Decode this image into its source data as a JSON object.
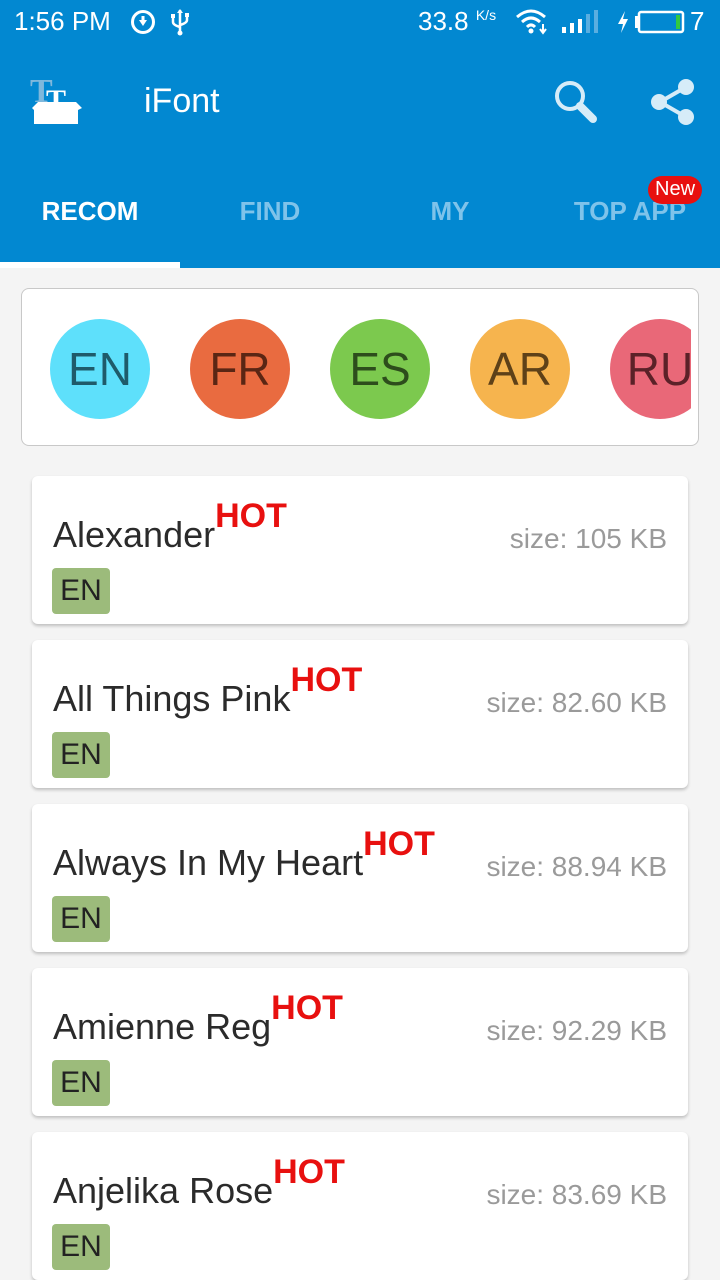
{
  "status_bar": {
    "time": "1:56 PM",
    "net_speed": "33.8",
    "net_speed_unit": "K/s",
    "battery_level": "7"
  },
  "toolbar": {
    "title": "iFont",
    "logo_icon": "ifont-box-logo-icon",
    "search_icon": "search-icon",
    "share_icon": "share-icon"
  },
  "tabs": [
    {
      "label": "RECOM",
      "active": true
    },
    {
      "label": "FIND",
      "active": false
    },
    {
      "label": "MY",
      "active": false
    },
    {
      "label": "TOP APP",
      "active": false,
      "badge": "New"
    }
  ],
  "languages": [
    {
      "code": "EN",
      "color": "#5ee0fb",
      "text_color": "#1f5b6a"
    },
    {
      "code": "FR",
      "color": "#e96b40",
      "text_color": "#5a2614"
    },
    {
      "code": "ES",
      "color": "#7cc94e",
      "text_color": "#2d4d1c"
    },
    {
      "code": "AR",
      "color": "#f6b44e",
      "text_color": "#5e4118"
    },
    {
      "code": "RU",
      "color": "#e96878",
      "text_color": "#5b2128"
    }
  ],
  "fonts": [
    {
      "name": "Alexander",
      "hot": "HOT",
      "size": "size: 105 KB",
      "lang": "EN"
    },
    {
      "name": "All Things Pink",
      "hot": "HOT",
      "size": "size: 82.60 KB",
      "lang": "EN"
    },
    {
      "name": "Always In My Heart",
      "hot": "HOT",
      "size": "size: 88.94 KB",
      "lang": "EN"
    },
    {
      "name": "Amienne Reg",
      "hot": "HOT",
      "size": "size: 92.29 KB",
      "lang": "EN"
    },
    {
      "name": "Anjelika Rose",
      "hot": "HOT",
      "size": "size: 83.69 KB",
      "lang": "EN"
    }
  ],
  "colors": {
    "primary": "#0288d1",
    "hot": "#e8100f",
    "tag": "#9cbb7b",
    "inactive_tab": "#7fc3ea"
  }
}
